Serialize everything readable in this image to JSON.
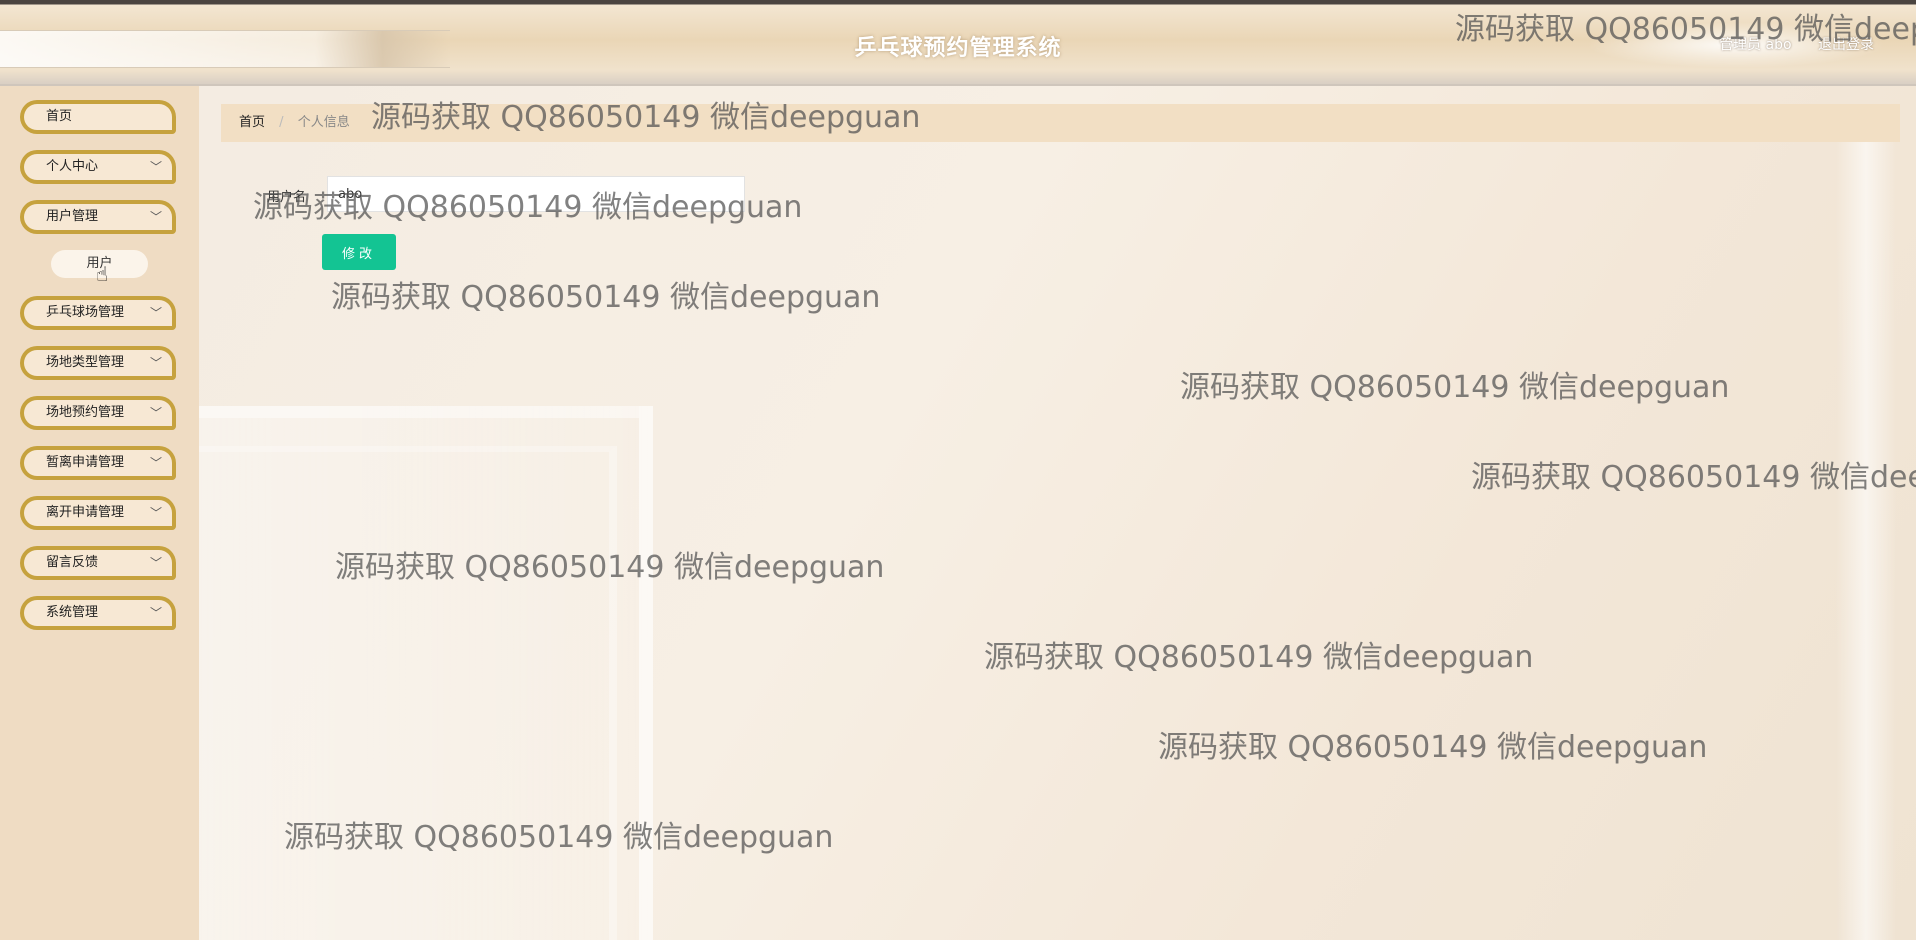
{
  "header": {
    "title": "乒乓球预约管理系统",
    "user_label": "管理员 abo",
    "logout_label": "退出登录"
  },
  "sidebar": {
    "items": [
      {
        "label": "首页",
        "has_children": false
      },
      {
        "label": "个人中心",
        "has_children": true
      },
      {
        "label": "用户管理",
        "has_children": true
      },
      {
        "label": "乒乓球场管理",
        "has_children": true
      },
      {
        "label": "场地类型管理",
        "has_children": true
      },
      {
        "label": "场地预约管理",
        "has_children": true
      },
      {
        "label": "暂离申请管理",
        "has_children": true
      },
      {
        "label": "离开申请管理",
        "has_children": true
      },
      {
        "label": "留言反馈",
        "has_children": true
      },
      {
        "label": "系统管理",
        "has_children": true
      }
    ],
    "expanded_sub_item": "用户",
    "chevron": "﹀"
  },
  "breadcrumb": {
    "home": "首页",
    "separator": "/",
    "current": "个人信息"
  },
  "form": {
    "username_label": "用户名",
    "username_value": "abo",
    "submit_label": "修改"
  },
  "watermark": {
    "text": "源码获取 QQ86050149 微信deepguan"
  },
  "colors": {
    "accent": "#13c493",
    "nav_border": "#c6a23e",
    "sidebar_bg": "#efdcc3",
    "breadcrumb_bg": "#f2dfc4"
  }
}
